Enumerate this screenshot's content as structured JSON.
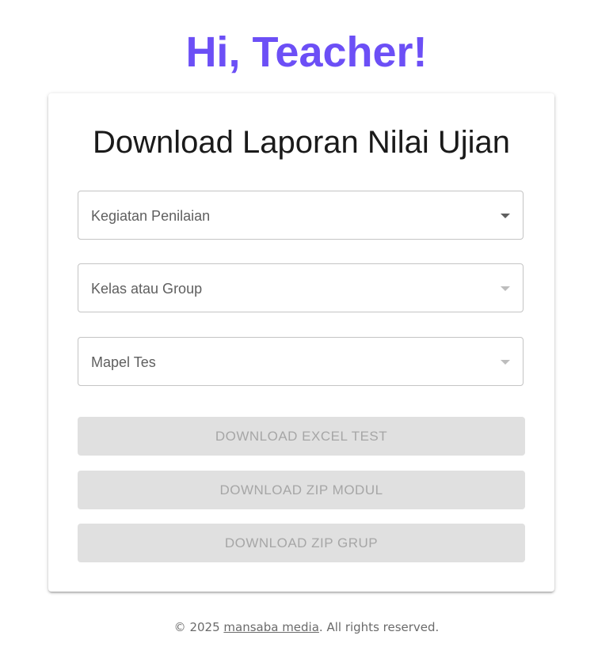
{
  "header": {
    "greeting": "Hi, Teacher!"
  },
  "form": {
    "title": "Download Laporan Nilai Ujian",
    "selects": [
      {
        "label": "Kegiatan Penilaian",
        "enabled": true
      },
      {
        "label": "Kelas atau Group",
        "enabled": false
      },
      {
        "label": "Mapel Tes",
        "enabled": false
      }
    ],
    "buttons": [
      {
        "label": "DOWNLOAD EXCEL TEST",
        "enabled": false
      },
      {
        "label": "DOWNLOAD ZIP MODUL",
        "enabled": false
      },
      {
        "label": "DOWNLOAD ZIP GRUP",
        "enabled": false
      }
    ]
  },
  "footer": {
    "prefix": "© 2025 ",
    "link_text": "mansaba media",
    "suffix": ". All rights reserved."
  },
  "colors": {
    "accent": "#6c4ff6",
    "disabled_button_bg": "#e0e0e0",
    "disabled_text": "#a6a6a6"
  },
  "icons": {
    "dropdown": "chevron-down-icon"
  }
}
